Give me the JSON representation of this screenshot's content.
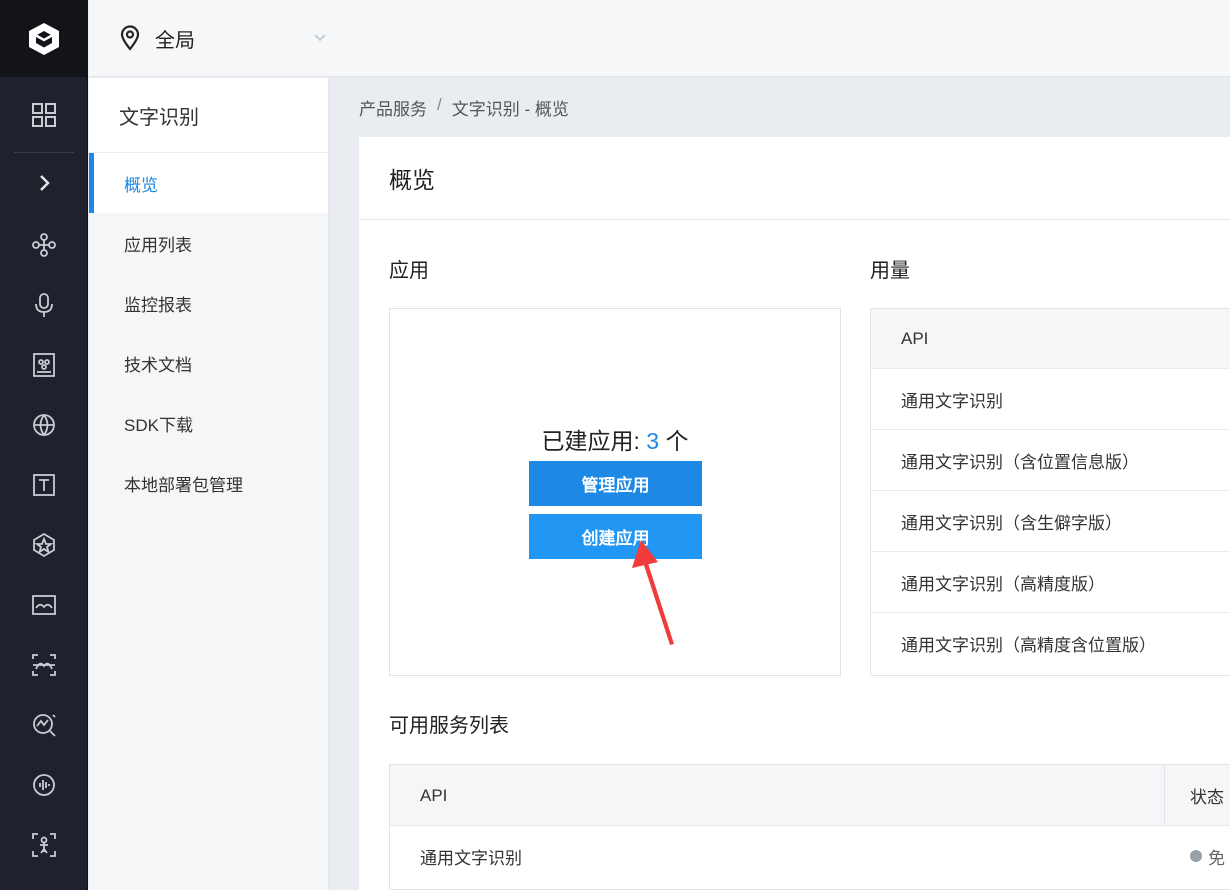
{
  "topbar": {
    "region_label": "全局"
  },
  "subnav": {
    "title": "文字识别",
    "items": [
      {
        "label": "概览",
        "active": true
      },
      {
        "label": "应用列表"
      },
      {
        "label": "监控报表"
      },
      {
        "label": "技术文档"
      },
      {
        "label": "SDK下载"
      },
      {
        "label": "本地部署包管理"
      }
    ]
  },
  "breadcrumb": {
    "root": "产品服务",
    "separator": "/",
    "current": "文字识别 - 概览"
  },
  "panel": {
    "title": "概览"
  },
  "apps": {
    "section_title": "应用",
    "count_prefix": "已建应用: ",
    "count": "3",
    "count_suffix": " 个",
    "manage_button": "管理应用",
    "create_button": "创建应用"
  },
  "usage": {
    "section_title": "用量",
    "header": "API",
    "rows": [
      "通用文字识别",
      "通用文字识别（含位置信息版）",
      "通用文字识别（含生僻字版）",
      "通用文字识别（高精度版）",
      "通用文字识别（高精度含位置版）"
    ]
  },
  "services": {
    "section_title": "可用服务列表",
    "col_api": "API",
    "col_status": "状态",
    "rows": [
      {
        "api": "通用文字识别",
        "status": "免"
      }
    ]
  },
  "colors": {
    "accent": "#1e88e5",
    "rail_bg": "#1f222c",
    "annotation_arrow": "#f03c3c"
  },
  "icons": {
    "rail": [
      "logo-icon",
      "grid-icon",
      "expand-icon",
      "network-icon",
      "microphone-icon",
      "image-recognition-icon",
      "globe-icon",
      "text-icon",
      "hexagon-icon",
      "landscape-icon",
      "face-icon",
      "analytics-icon",
      "audio-icon",
      "body-detect-icon"
    ]
  }
}
